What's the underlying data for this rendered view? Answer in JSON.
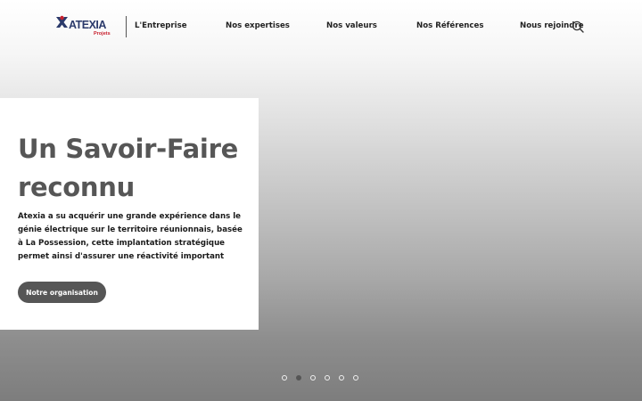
{
  "header": {
    "logo": {
      "brand": "ATEXIA",
      "sub": "Projets",
      "colors": {
        "brand": "#2b3a6b",
        "accent": "#c8202e"
      }
    },
    "nav": [
      {
        "label": "L'Entreprise"
      },
      {
        "label": "Nos expertises"
      },
      {
        "label": "Nos valeurs"
      },
      {
        "label": "Nos Références"
      },
      {
        "label": "Nous rejoindre"
      }
    ],
    "search_icon": "search-icon"
  },
  "hero": {
    "title": "Un Savoir-Faire reconnu",
    "body": "Atexia a su acquérir une grande expérience dans le génie électrique sur le territoire réunionnais, basée à La Possession, cette implantation stratégique permet ainsi d'assurer une réactivité important",
    "button_label": "Notre organisation",
    "button_color": "#565656"
  },
  "carousel": {
    "slide_count": 6,
    "active_index": 2
  }
}
